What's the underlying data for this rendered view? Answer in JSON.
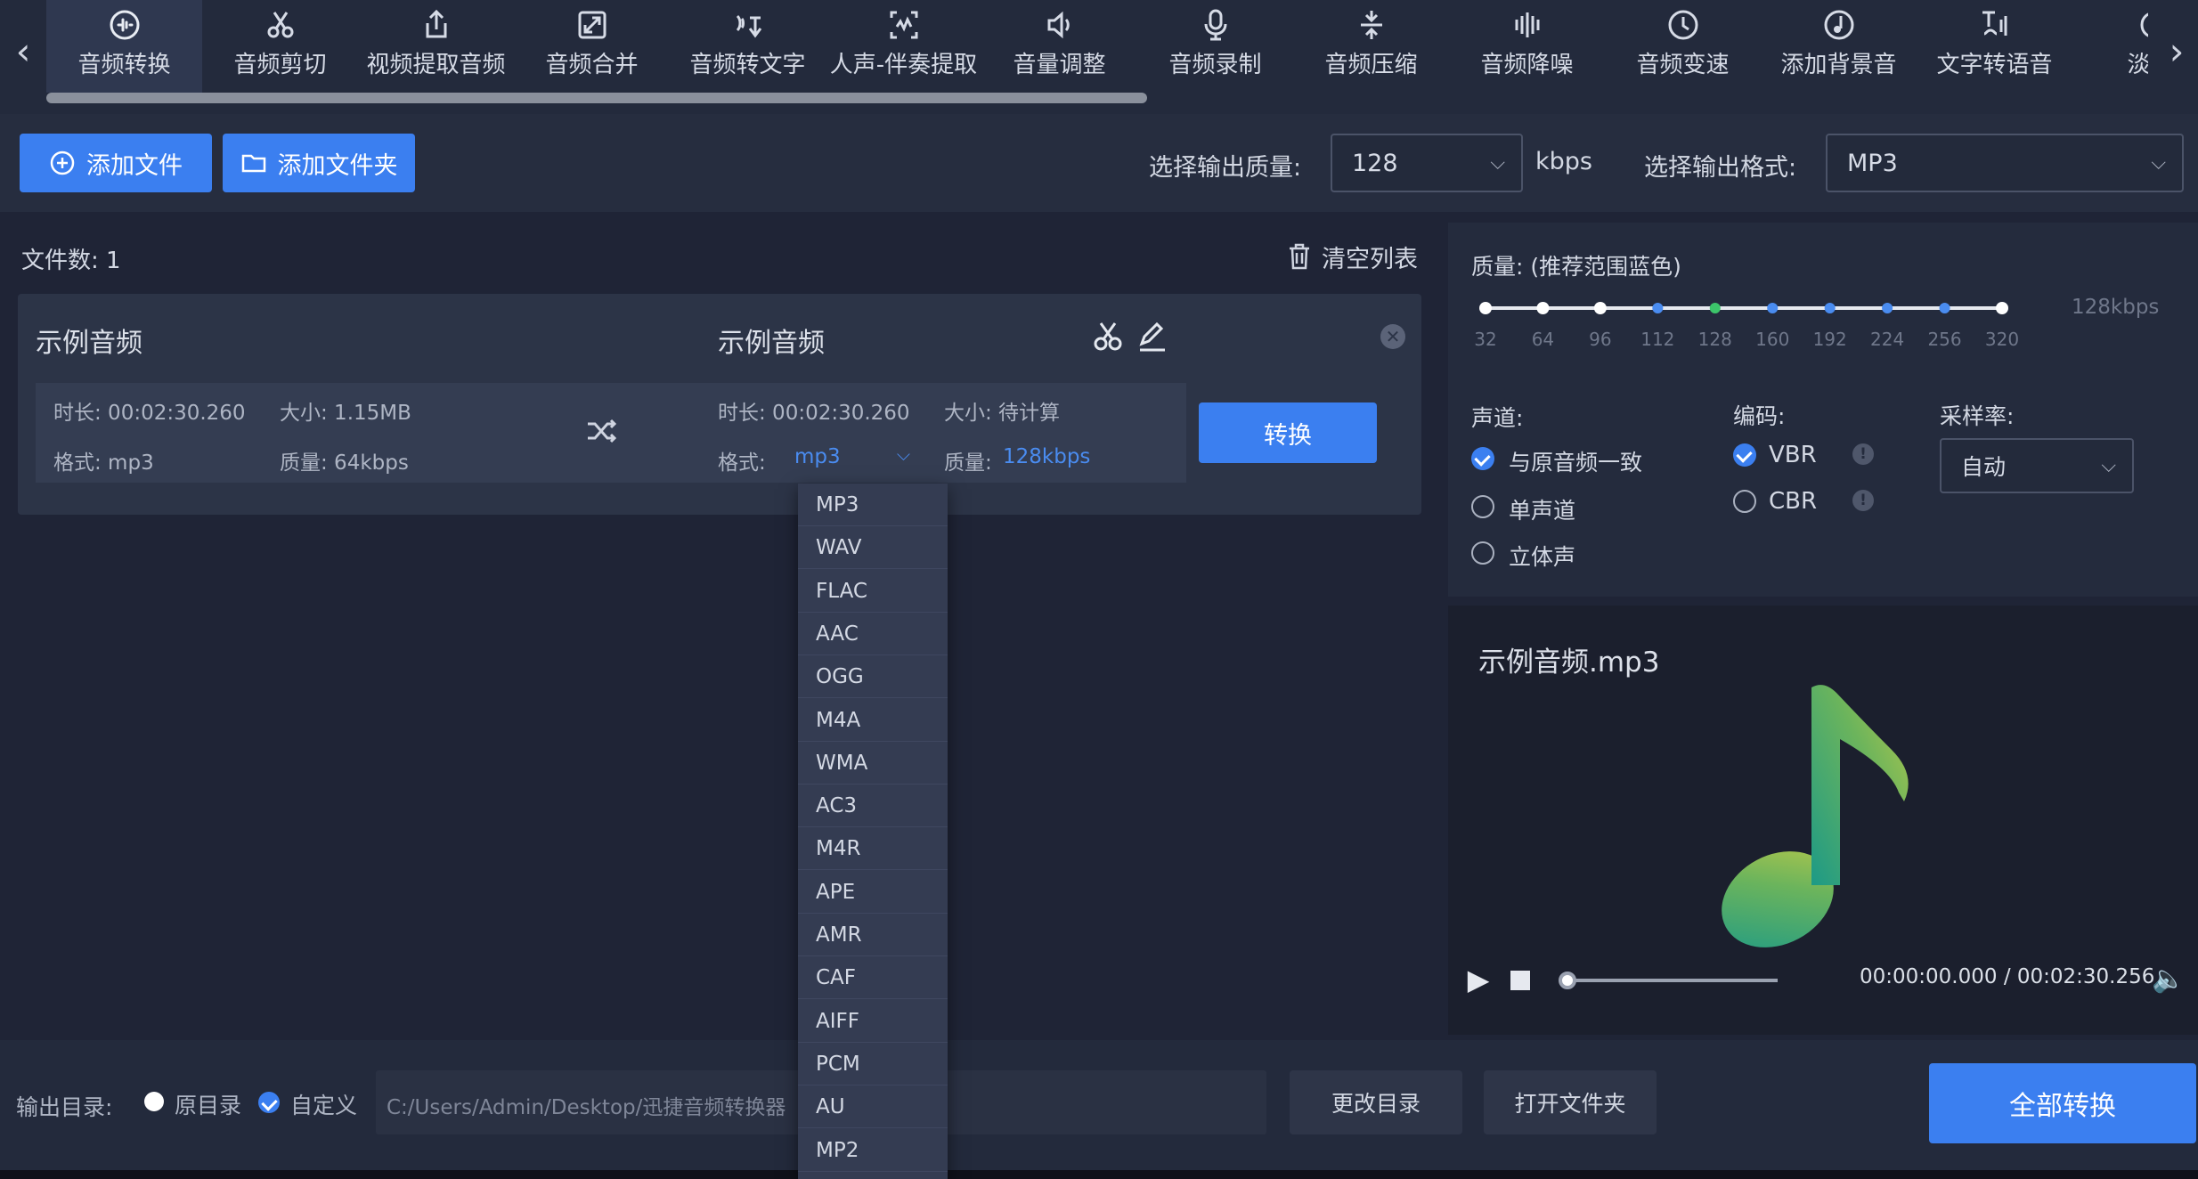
{
  "toolbar": {
    "tabs": [
      {
        "label": "音频转换",
        "icon": "audio-convert-icon",
        "active": true
      },
      {
        "label": "音频剪切",
        "icon": "scissors-icon"
      },
      {
        "label": "视频提取音频",
        "icon": "export-icon"
      },
      {
        "label": "音频合并",
        "icon": "merge-icon"
      },
      {
        "label": "音频转文字",
        "icon": "speech-to-text-icon"
      },
      {
        "label": "人声-伴奏提取",
        "icon": "vocal-extract-icon"
      },
      {
        "label": "音量调整",
        "icon": "volume-adjust-icon"
      },
      {
        "label": "音频录制",
        "icon": "microphone-icon"
      },
      {
        "label": "音频压缩",
        "icon": "compress-icon"
      },
      {
        "label": "音频降噪",
        "icon": "denoise-icon"
      },
      {
        "label": "音频变速",
        "icon": "speed-icon"
      },
      {
        "label": "添加背景音",
        "icon": "background-music-icon"
      },
      {
        "label": "文字转语音",
        "icon": "text-to-speech-icon"
      },
      {
        "label": "淡入",
        "icon": "fade-icon"
      }
    ]
  },
  "actions": {
    "add_file": "添加文件",
    "add_folder": "添加文件夹",
    "quality_label": "选择输出质量:",
    "quality_value": "128",
    "quality_unit": "kbps",
    "format_label": "选择输出格式:",
    "format_value": "MP3"
  },
  "file_list": {
    "count_label": "文件数:",
    "count": "1",
    "clear_label": "清空列表",
    "file": {
      "src_name": "示例音频",
      "dst_name": "示例音频",
      "src_duration": "时长: 00:02:30.260",
      "src_size": "大小: 1.15MB",
      "src_format": "格式: mp3",
      "src_quality": "质量: 64kbps",
      "dst_duration": "时长: 00:02:30.260",
      "dst_size": "大小: 待计算",
      "dst_format_label": "格式:",
      "dst_format_value": "mp3",
      "dst_quality_label": "质量:",
      "dst_quality_value": "128kbps",
      "convert_label": "转换"
    }
  },
  "format_dropdown": {
    "options": [
      "MP3",
      "WAV",
      "FLAC",
      "AAC",
      "OGG",
      "M4A",
      "WMA",
      "AC3",
      "M4R",
      "APE",
      "AMR",
      "CAF",
      "AIFF",
      "PCM",
      "AU",
      "MP2"
    ]
  },
  "settings": {
    "quality_title": "质量: (推荐范围蓝色)",
    "quality_ticks": [
      "32",
      "64",
      "96",
      "112",
      "128",
      "160",
      "192",
      "224",
      "256",
      "320"
    ],
    "quality_current": "128kbps",
    "selected_tick_index": 4,
    "channel_label": "声道:",
    "channel_options": [
      "与原音频一致",
      "单声道",
      "立体声"
    ],
    "channel_selected": 0,
    "encoding_label": "编码:",
    "encoding_options": [
      "VBR",
      "CBR"
    ],
    "encoding_selected": 0,
    "sample_rate_label": "采样率:",
    "sample_rate_value": "自动"
  },
  "preview": {
    "file_name": "示例音频.mp3",
    "time": "00:00:00.000 / 00:02:30.256",
    "progress": 0
  },
  "bottom": {
    "output_label": "输出目录:",
    "option_original": "原目录",
    "option_custom": "自定义",
    "selected": "custom",
    "path": "C:/Users/Admin/Desktop/迅捷音频转换器",
    "change_dir": "更改目录",
    "open_folder": "打开文件夹",
    "convert_all": "全部转换"
  },
  "colors": {
    "accent": "#3b7ff0",
    "background": "#1f2436",
    "recommended_tick": "#4a8cf0",
    "selected_tick": "#3cc46a"
  }
}
